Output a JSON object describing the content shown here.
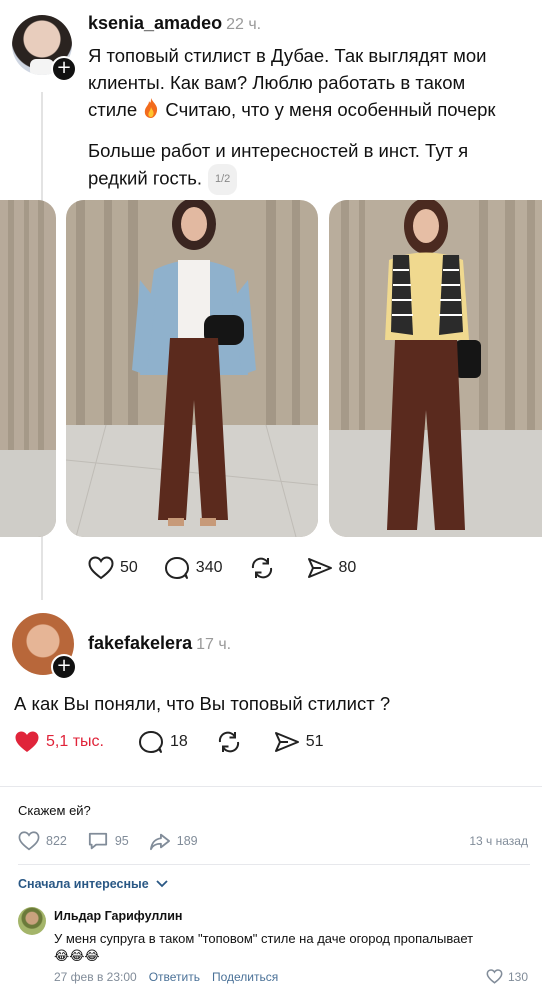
{
  "post1": {
    "username": "ksenia_amadeo",
    "time": "22 ч.",
    "text_line1": "Я топовый стилист в Дубае. Так выглядят мои",
    "text_line2": "клиенты. Как вам? Люблю работать в таком",
    "text_line3_a": "стиле ",
    "text_line3_b": " Считаю, что у меня особенный почерк",
    "text2_line1": "Больше работ и интересностей в инст. Тут я",
    "text2_line2": "редкий гость.",
    "page_badge": "1/2",
    "likes": "50",
    "comments": "340",
    "shares": "80"
  },
  "post2": {
    "username": "fakefakelera",
    "time": "17 ч.",
    "text": "А как Вы поняли, что Вы топовый стилист ?",
    "likes": "5,1 тыс.",
    "comments": "18",
    "shares": "51"
  },
  "vk": {
    "caption": "Скажем ей?",
    "likes": "822",
    "comments": "95",
    "shares": "189",
    "time": "13 ч назад",
    "sort_label": "Сначала интересные",
    "comment": {
      "author": "Ильдар Гарифуллин",
      "text_line1": "У меня супруга в таком \"топовом\" стиле на даче огород пропалывает",
      "emoji": "😂😂😂",
      "date": "27 фев в 23:00",
      "reply": "Ответить",
      "share": "Поделиться",
      "likes": "130"
    }
  },
  "colors": {
    "liked": "#e0243a",
    "vk_link": "#2a5885",
    "muted": "#818c99"
  },
  "icons": [
    "heart-icon",
    "comment-icon",
    "repost-icon",
    "send-icon",
    "share-icon",
    "fire-icon",
    "chevron-down-icon"
  ]
}
